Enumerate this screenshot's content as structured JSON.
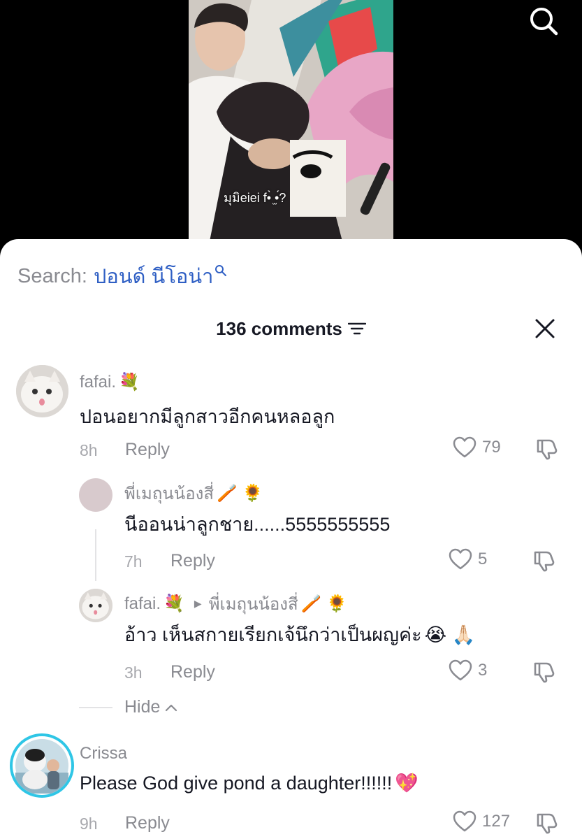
{
  "video": {
    "overlay_text": "มุมิeiei f•̀ ̫•́?"
  },
  "search": {
    "prefix": "Search:",
    "term": "ปอนด์ นีโอน่า"
  },
  "header": {
    "count_label": "136 comments"
  },
  "comments": [
    {
      "username": "fafai.",
      "username_emoji": "💐",
      "text": "ปอนอยากมีลูกสาวอีกคนหลอลูก",
      "time": "8h",
      "reply_label": "Reply",
      "likes": "79"
    },
    {
      "username": "พี่เมถุนน้องสี่",
      "username_emoji": "🪥 🌻",
      "text": "นีออนน่าลูกชาย......5555555555",
      "time": "7h",
      "reply_label": "Reply",
      "likes": "5"
    },
    {
      "username": "fafai.",
      "username_emoji": "💐",
      "reply_to": "พี่เมถุนน้องสี่",
      "reply_to_emoji": "🪥 🌻",
      "text": "อ้าว เห็นสกายเรียกเจ้นึกว่าเป็นผญค่ะ",
      "text_emoji": "😭 🙏🏻",
      "time": "3h",
      "reply_label": "Reply",
      "likes": "3"
    },
    {
      "username": "Crissa",
      "text": "Please God give pond a daughter!!!!!!",
      "text_emoji": "💖",
      "time": "9h",
      "reply_label": "Reply",
      "likes": "127"
    }
  ],
  "hide_label": "Hide",
  "colors": {
    "link_blue": "#2f5fc4",
    "muted_gray": "#8a8b91",
    "text_dark": "#161823",
    "story_ring": "#2fc6e6"
  },
  "icons": [
    "search-icon",
    "filter-icon",
    "close-icon",
    "heart-icon",
    "dislike-icon",
    "chevron-up-icon",
    "caret-right-icon"
  ]
}
